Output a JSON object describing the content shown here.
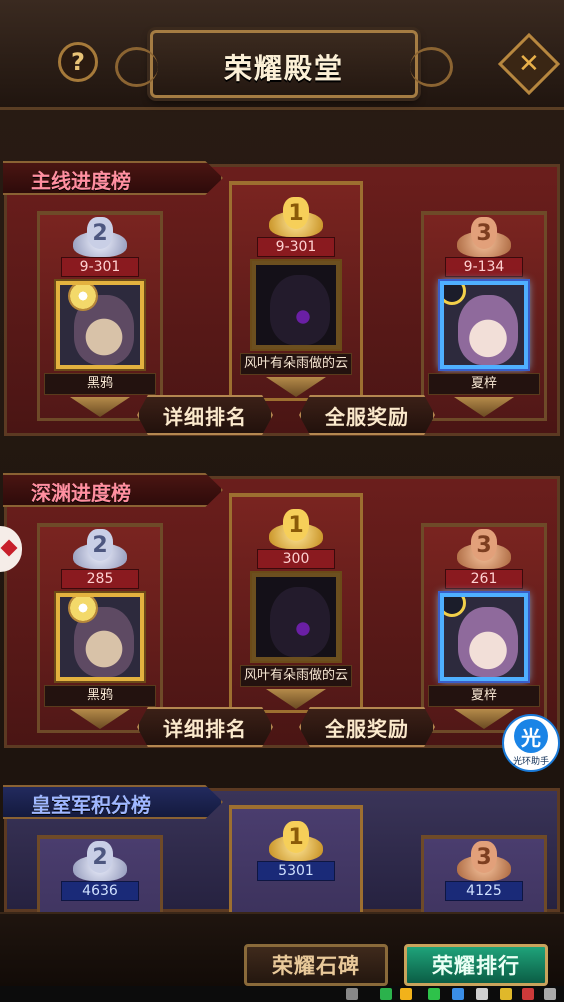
{
  "header": {
    "title": "荣耀殿堂",
    "help_icon": "?",
    "close_icon": "✕"
  },
  "boards": [
    {
      "title": "主线进度榜",
      "theme": "red",
      "second": {
        "rank": "2",
        "progress": "9-301",
        "name": "黑鸦"
      },
      "first": {
        "rank": "1",
        "progress": "9-301",
        "name": "风叶有朵雨做的云"
      },
      "third": {
        "rank": "3",
        "progress": "9-134",
        "name": "夏梓"
      },
      "buttons": {
        "detail": "详细排名",
        "reward": "全服奖励"
      }
    },
    {
      "title": "深渊进度榜",
      "theme": "red",
      "second": {
        "rank": "2",
        "progress": "285",
        "name": "黑鸦"
      },
      "first": {
        "rank": "1",
        "progress": "300",
        "name": "风叶有朵雨做的云"
      },
      "third": {
        "rank": "3",
        "progress": "261",
        "name": "夏梓"
      },
      "buttons": {
        "detail": "详细排名",
        "reward": "全服奖励"
      }
    },
    {
      "title": "皇室军积分榜",
      "theme": "blue",
      "second": {
        "rank": "2",
        "progress": "4636"
      },
      "first": {
        "rank": "1",
        "progress": "5301"
      },
      "third": {
        "rank": "3",
        "progress": "4125"
      }
    }
  ],
  "helper": {
    "glyph": "光",
    "label": "光环助手"
  },
  "bottom_tabs": {
    "stele": "荣耀石碑",
    "ranking": "荣耀排行"
  },
  "colors": {
    "accent_gold": "#d6a43a",
    "active_tab": "#1fa37a",
    "panel_red": "#6b1e1c",
    "panel_blue": "#3a3458"
  }
}
